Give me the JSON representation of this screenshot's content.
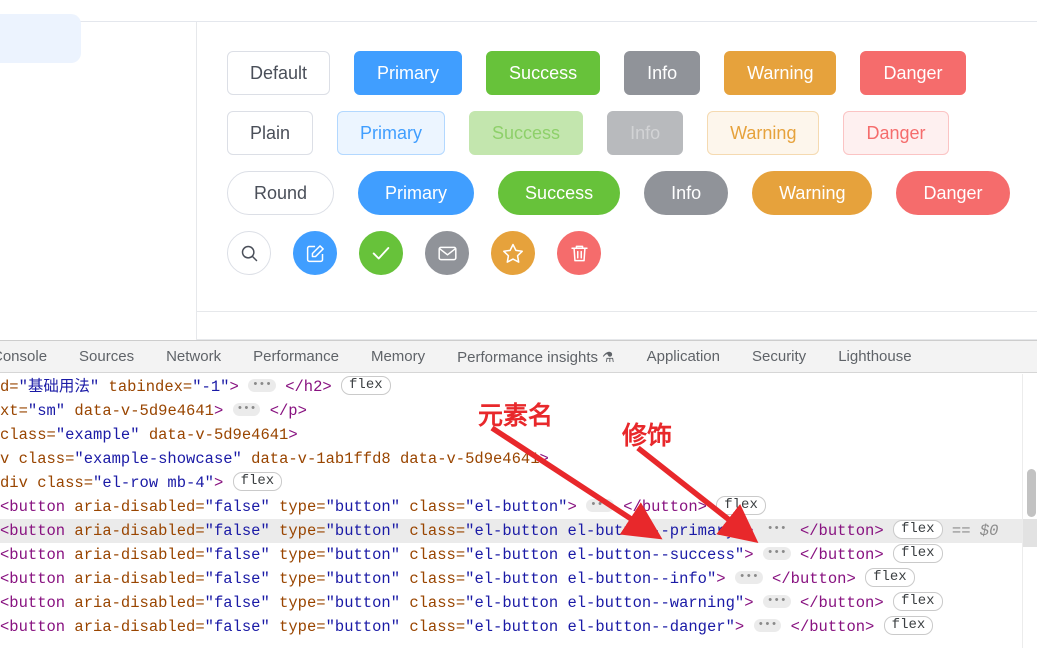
{
  "page": {
    "card": {
      "rows": [
        {
          "name": "basic-row",
          "buttons": [
            {
              "label": "Default",
              "variant": "default"
            },
            {
              "label": "Primary",
              "variant": "primary"
            },
            {
              "label": "Success",
              "variant": "success"
            },
            {
              "label": "Info",
              "variant": "info"
            },
            {
              "label": "Warning",
              "variant": "warning"
            },
            {
              "label": "Danger",
              "variant": "danger"
            }
          ]
        },
        {
          "name": "plain-row",
          "buttons": [
            {
              "label": "Plain",
              "variant": "plain-default"
            },
            {
              "label": "Primary",
              "variant": "plain-primary"
            },
            {
              "label": "Success",
              "variant": "plain-success"
            },
            {
              "label": "Info",
              "variant": "plain-info"
            },
            {
              "label": "Warning",
              "variant": "plain-warning"
            },
            {
              "label": "Danger",
              "variant": "plain-danger"
            }
          ]
        },
        {
          "name": "round-row",
          "buttons": [
            {
              "label": "Round",
              "variant": "default"
            },
            {
              "label": "Primary",
              "variant": "primary"
            },
            {
              "label": "Success",
              "variant": "success"
            },
            {
              "label": "Info",
              "variant": "info"
            },
            {
              "label": "Warning",
              "variant": "warning"
            },
            {
              "label": "Danger",
              "variant": "danger"
            }
          ]
        },
        {
          "name": "icon-row",
          "buttons": [
            {
              "icon": "search-icon",
              "variant": "default"
            },
            {
              "icon": "edit-icon",
              "variant": "primary"
            },
            {
              "icon": "check-icon",
              "variant": "success"
            },
            {
              "icon": "message-icon",
              "variant": "info"
            },
            {
              "icon": "star-icon",
              "variant": "warning"
            },
            {
              "icon": "delete-icon",
              "variant": "danger"
            }
          ]
        }
      ]
    },
    "colors": {
      "primary": "#409EFF",
      "success": "#67C23A",
      "info": "#909399",
      "warning": "#E6A23C",
      "danger": "#F56C6C",
      "border": "#DCDFE6",
      "text": "#4A4F59"
    }
  },
  "devtools": {
    "tabs": [
      {
        "label": "Console",
        "clipped": true
      },
      {
        "label": "Sources"
      },
      {
        "label": "Network"
      },
      {
        "label": "Performance"
      },
      {
        "label": "Memory"
      },
      {
        "label": "Performance insights",
        "badge": "⚗"
      },
      {
        "label": "Application"
      },
      {
        "label": "Security"
      },
      {
        "label": "Lighthouse"
      }
    ],
    "code": {
      "l1": {
        "a": "d=",
        "b": "\"基础用法\"",
        "c": " tabindex=",
        "d": "\"-1\"",
        "e": ">",
        "f": "</h2>",
        "badge": "flex"
      },
      "l2": {
        "a": "xt=",
        "b": "\"sm\"",
        "c": " data-v-5d9e4641",
        "d": ">",
        "e": "</p>"
      },
      "l3": {
        "a": "class=",
        "b": "\"example\"",
        "c": " data-v-5d9e4641",
        "d": ">"
      },
      "l4": {
        "a": "v class=",
        "b": "\"example-showcase\"",
        "c": " data-v-1ab1ffd8 data-v-5d9e4641",
        "d": ">"
      },
      "l5": {
        "a": "div class=",
        "b": "\"el-row mb-4\"",
        "c": ">",
        "badge": "flex"
      },
      "buttons": [
        {
          "open": "<button ",
          "attr1": "aria-disabled=",
          "val1": "\"false\"",
          "attr2": " type=",
          "val2": "\"button\"",
          "attr3": " class=",
          "val3": "\"el-button\"",
          "close": ">",
          "endtag": "</button>",
          "badge": "flex",
          "selected": false,
          "dollar": ""
        },
        {
          "open": "<button ",
          "attr1": "aria-disabled=",
          "val1": "\"false\"",
          "attr2": " type=",
          "val2": "\"button\"",
          "attr3": " class=",
          "val3": "\"el-button el-button--primary\"",
          "close": ">",
          "endtag": "</button>",
          "badge": "flex",
          "selected": true,
          "dollar": "== $0"
        },
        {
          "open": "<button ",
          "attr1": "aria-disabled=",
          "val1": "\"false\"",
          "attr2": " type=",
          "val2": "\"button\"",
          "attr3": " class=",
          "val3": "\"el-button el-button--success\"",
          "close": ">",
          "endtag": "</button>",
          "badge": "flex",
          "selected": false,
          "dollar": ""
        },
        {
          "open": "<button ",
          "attr1": "aria-disabled=",
          "val1": "\"false\"",
          "attr2": " type=",
          "val2": "\"button\"",
          "attr3": " class=",
          "val3": "\"el-button el-button--info\"",
          "close": ">",
          "endtag": "</button>",
          "badge": "flex",
          "selected": false,
          "dollar": ""
        },
        {
          "open": "<button ",
          "attr1": "aria-disabled=",
          "val1": "\"false\"",
          "attr2": " type=",
          "val2": "\"button\"",
          "attr3": " class=",
          "val3": "\"el-button el-button--warning\"",
          "close": ">",
          "endtag": "</button>",
          "badge": "flex",
          "selected": false,
          "dollar": ""
        },
        {
          "open": "<button ",
          "attr1": "aria-disabled=",
          "val1": "\"false\"",
          "attr2": " type=",
          "val2": "\"button\"",
          "attr3": " class=",
          "val3": "\"el-button el-button--danger\"",
          "close": ">",
          "endtag": "</button>",
          "badge": "flex",
          "selected": false,
          "dollar": ""
        }
      ]
    }
  },
  "annotations": [
    {
      "id": "element-name",
      "text": "元素名"
    },
    {
      "id": "modifier",
      "text": "修饰"
    }
  ]
}
